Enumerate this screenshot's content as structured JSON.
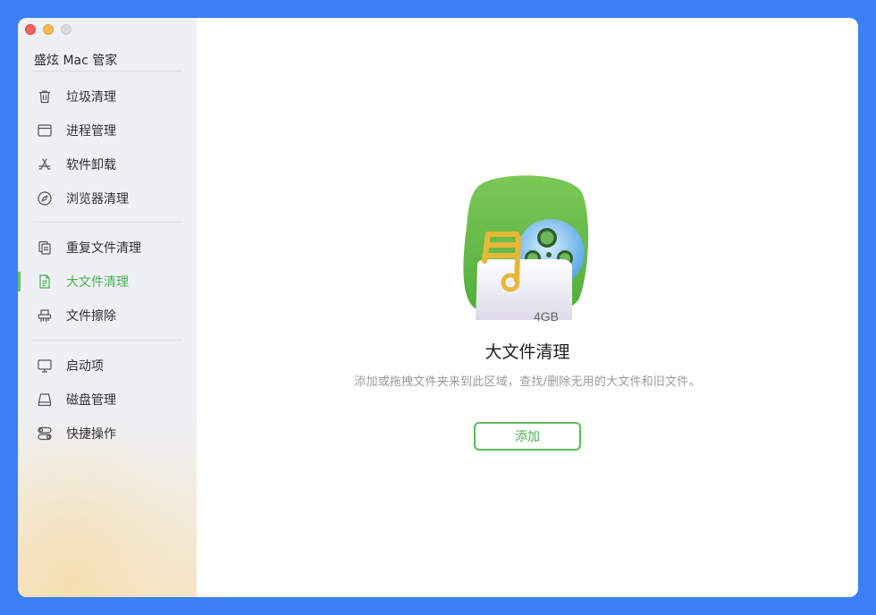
{
  "window": {
    "app_title": "盛炫 Mac 管家"
  },
  "sidebar": {
    "groups": [
      [
        {
          "label": "垃圾清理",
          "icon": "trash-icon"
        },
        {
          "label": "进程管理",
          "icon": "window-icon"
        },
        {
          "label": "软件卸载",
          "icon": "app-store-icon"
        },
        {
          "label": "浏览器清理",
          "icon": "compass-icon"
        }
      ],
      [
        {
          "label": "重复文件清理",
          "icon": "duplicate-files-icon"
        },
        {
          "label": "大文件清理",
          "icon": "document-icon",
          "active": true
        },
        {
          "label": "文件擦除",
          "icon": "shredder-icon"
        }
      ],
      [
        {
          "label": "启动项",
          "icon": "monitor-icon"
        },
        {
          "label": "磁盘管理",
          "icon": "disk-icon"
        },
        {
          "label": "快捷操作",
          "icon": "toggles-icon"
        }
      ]
    ],
    "active_color": "#4caf50"
  },
  "main": {
    "badge": "4GB",
    "title": "大文件清理",
    "description": "添加或拖拽文件夹来到此区域，查找/删除无用的大文件和旧文件。",
    "add_label": "添加",
    "accent": "#5cb85c"
  }
}
